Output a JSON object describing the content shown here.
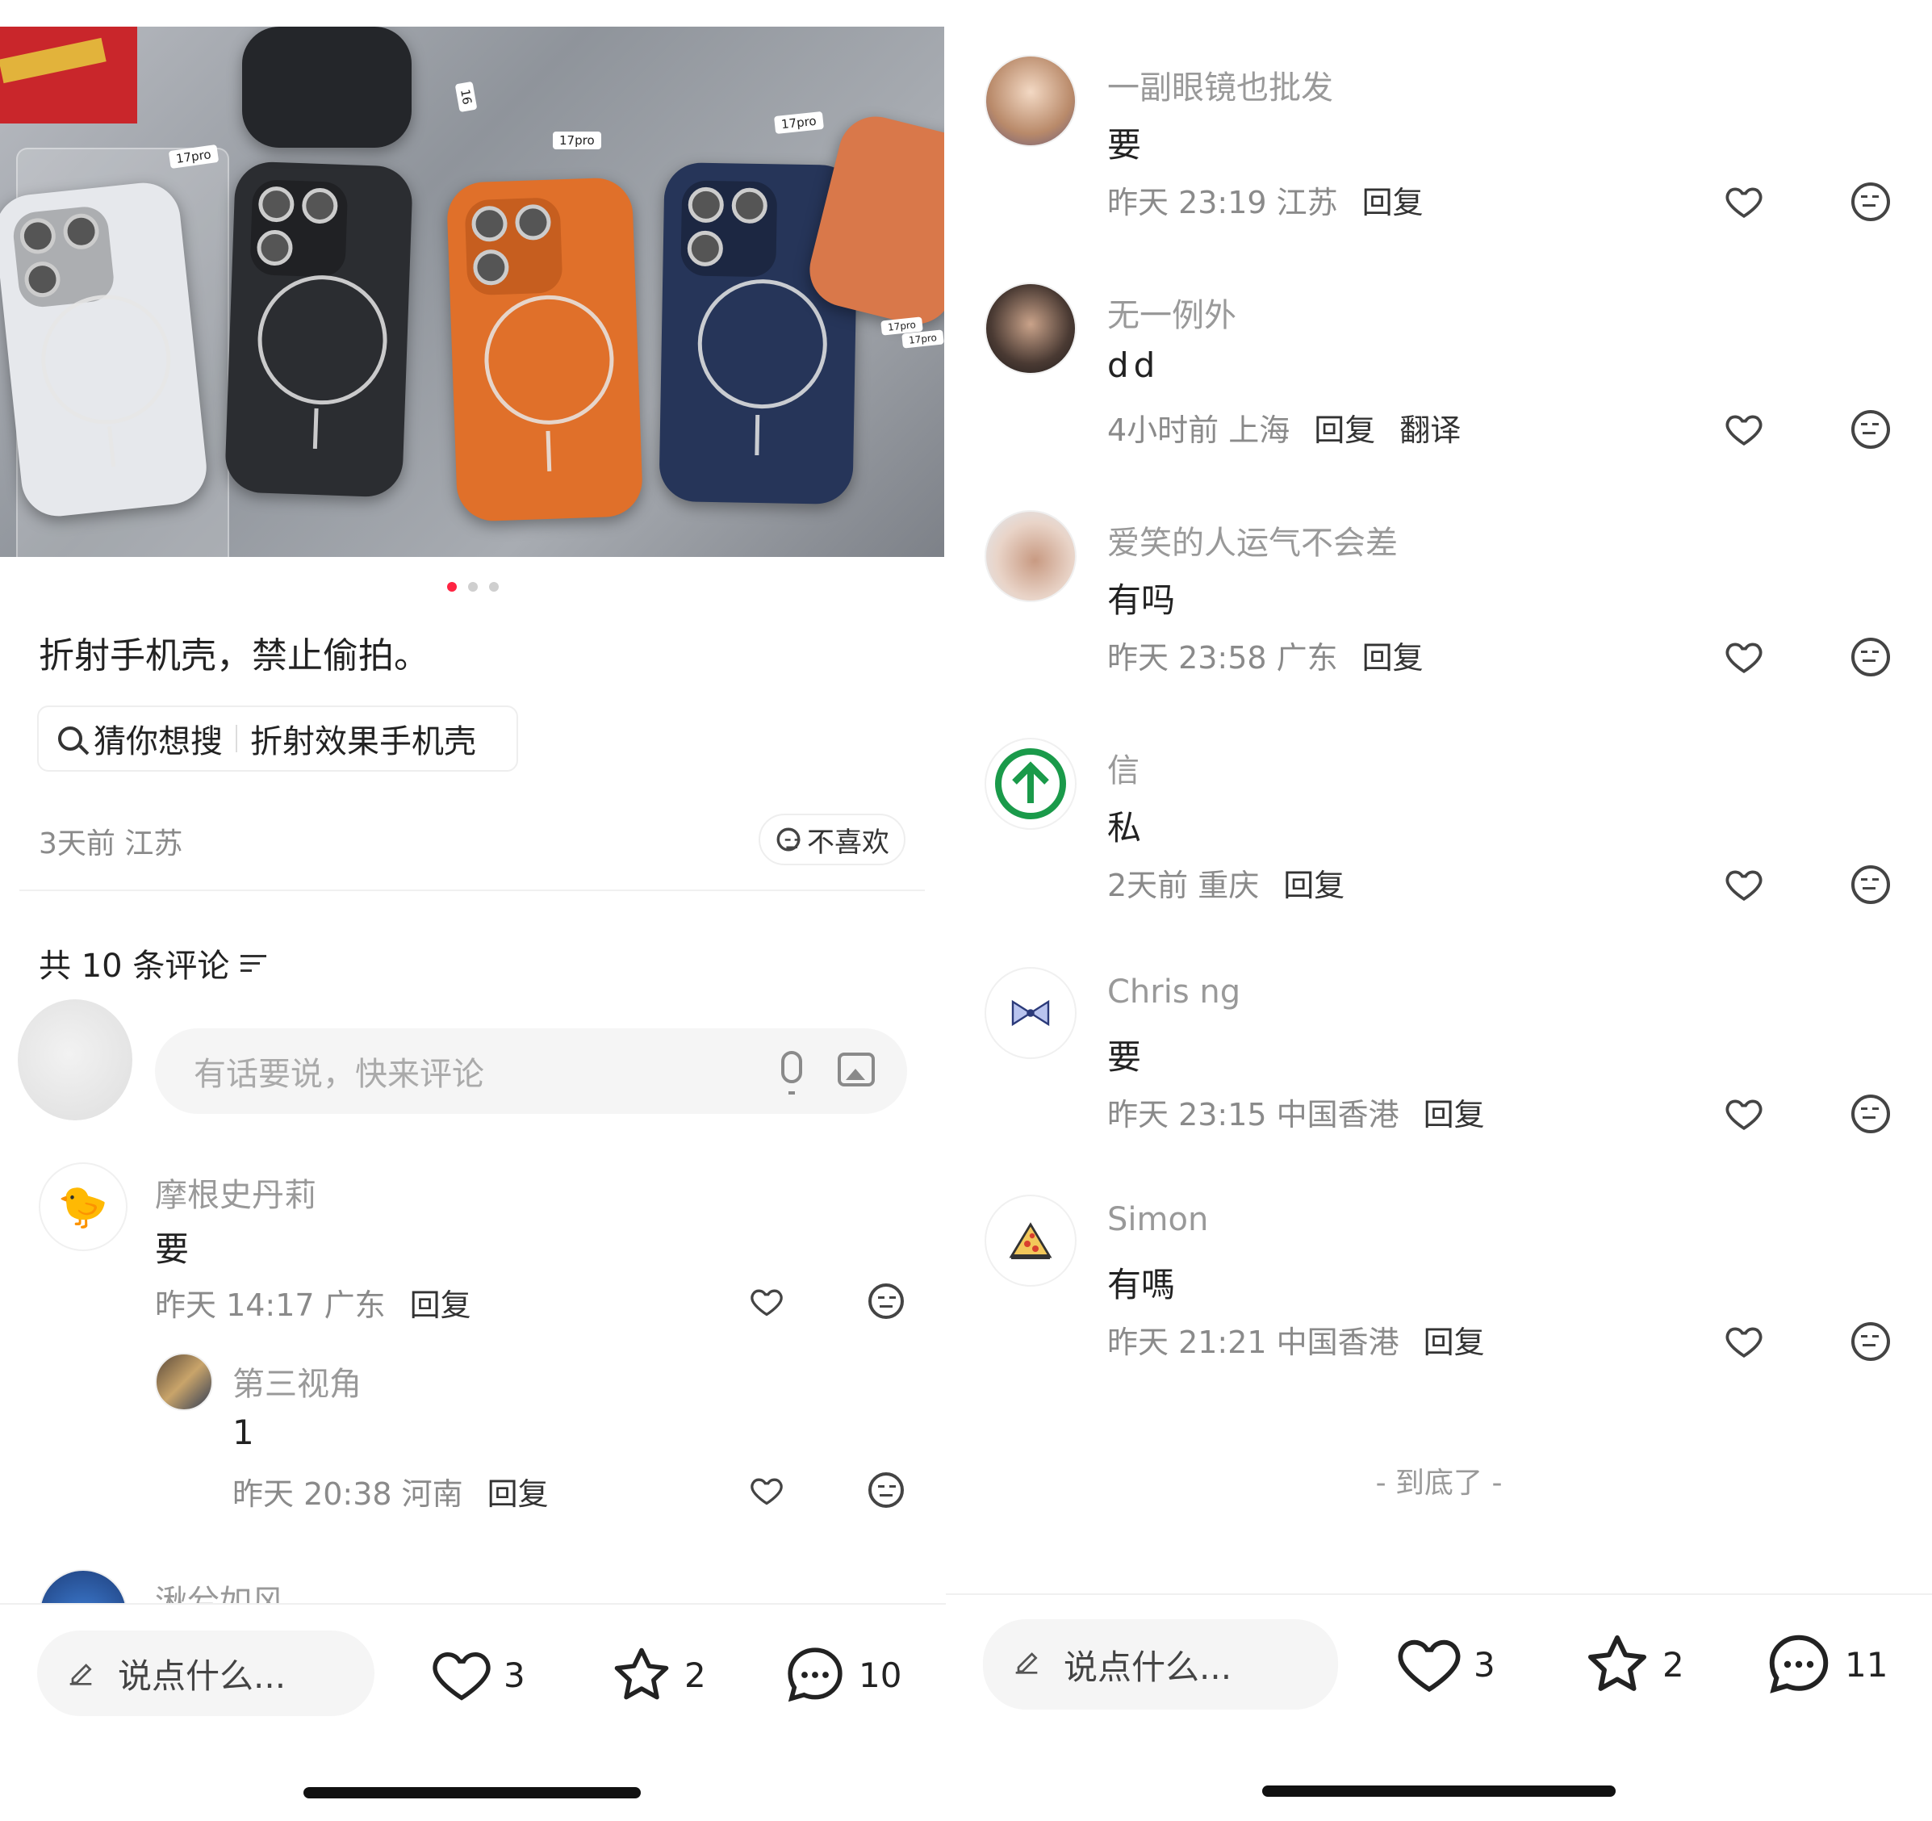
{
  "left": {
    "caption": "折射手机壳，禁止偷拍。",
    "search_chip": {
      "prefix": "猜你想搜",
      "query": "折射效果手机壳"
    },
    "photo_tags": [
      "17pro",
      "17pro",
      "17pro",
      "16",
      "17pro",
      "17pro"
    ],
    "carousel": {
      "total": 3,
      "active": 0
    },
    "post_meta": "3天前 江苏",
    "dislike_label": "不喜欢",
    "comments_title": "共 10 条评论",
    "input_placeholder": "有话要说，快来评论",
    "comments": [
      {
        "name": "摩根史丹莉",
        "text": "要",
        "meta": "昨天 14:17 广东",
        "reply": "回复"
      },
      {
        "name": "第三视角",
        "text": "1",
        "meta": "昨天 20:38 河南",
        "reply": "回复"
      },
      {
        "name": "湫兮如风"
      }
    ],
    "bottom": {
      "say_placeholder": "说点什么...",
      "likes": "3",
      "stars": "2",
      "comments": "10"
    }
  },
  "right": {
    "comments": [
      {
        "name": "一副眼镜也批发",
        "text": "要",
        "meta": "昨天 23:19 江苏",
        "reply": "回复"
      },
      {
        "name": "无一例外",
        "text": "dd",
        "meta": "4小时前 上海",
        "reply": "回复",
        "translate": "翻译"
      },
      {
        "name": "爱笑的人运气不会差",
        "text": "有吗",
        "meta": "昨天 23:58 广东",
        "reply": "回复"
      },
      {
        "name": "信",
        "text": "私",
        "meta": "2天前 重庆",
        "reply": "回复"
      },
      {
        "name": "Chris ng",
        "text": "要",
        "meta": "昨天 23:15 中国香港",
        "reply": "回复"
      },
      {
        "name": "Simon",
        "text": "有嗎",
        "meta": "昨天 21:21 中国香港",
        "reply": "回复"
      }
    ],
    "end_text": "- 到底了 -",
    "bottom": {
      "say_placeholder": "说点什么...",
      "likes": "3",
      "stars": "2",
      "comments": "11"
    }
  }
}
